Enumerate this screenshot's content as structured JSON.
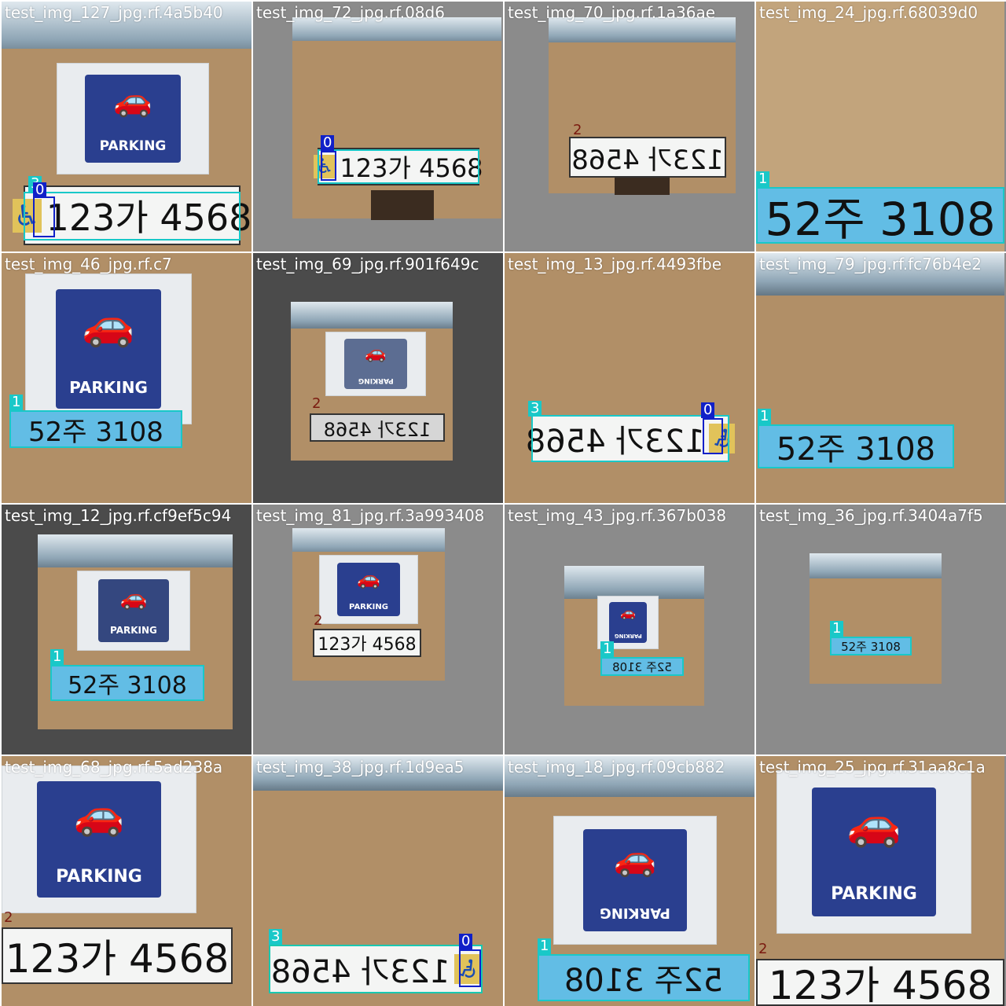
{
  "tile_filenames": [
    "test_img_127_jpg.rf.4a5b40",
    "test_img_72_jpg.rf.08d6",
    "test_img_70_jpg.rf.1a36ae",
    "test_img_24_jpg.rf.68039d0",
    "test_img_46_jpg.rf.c7",
    "test_img_69_jpg.rf.901f649c",
    "test_img_13_jpg.rf.4493fbe",
    "test_img_79_jpg.rf.fc76b4e2",
    "test_img_12_jpg.rf.cf9ef5c94",
    "test_img_81_jpg.rf.3a993408",
    "test_img_43_jpg.rf.367b038",
    "test_img_36_jpg.rf.3404a7f5",
    "test_img_68_jpg.rf.5ad238a",
    "test_img_38_jpg.rf.1d9ea5",
    "test_img_18_jpg.rf.09cb882",
    "test_img_25_jpg.rf.31aa8c1a"
  ],
  "parking_sign_text": "PARKING",
  "plates": {
    "white_normal": "123가 4568",
    "white_mirrored": "123가 4568",
    "blue_normal": "52주 3108",
    "blue_mirrored": "52주 3108"
  },
  "class_labels": {
    "c0": "0",
    "c1": "1",
    "c2": "2",
    "c3": "3"
  },
  "class_colors": {
    "c0": "#1020c8",
    "c1": "#19c8c8",
    "c2": "#f5f5f5",
    "c3": "#19c8b0"
  },
  "accessibility_icon": "wheelchair-icon"
}
